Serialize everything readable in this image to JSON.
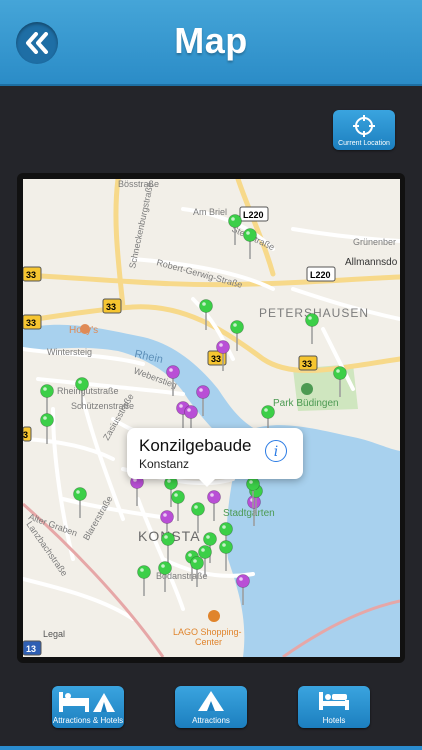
{
  "header": {
    "title": "Map",
    "back_icon": "double-chevron-left-icon"
  },
  "current_location": {
    "label": "Current Location",
    "icon": "crosshair-icon"
  },
  "map": {
    "callout": {
      "title": "Konzilgebaude",
      "subtitle": "Konstanz",
      "info_icon": "i"
    },
    "labels": {
      "boesstrasse": "Bösstraße",
      "schneckenburgstrasse": "Schneckenburgstraße",
      "am_briel": "Am Briel",
      "steinstrasse": "Steinstraße",
      "l220_a": "L220",
      "gruenenberg": "Grünenber",
      "allmannsdorf": "Allmannsdo",
      "robert_gerwig": "Robert-Gerwig-Straße",
      "l220_b": "L220",
      "b33_a": "33",
      "b33_b": "33",
      "b33_c": "33",
      "b33_d": "33",
      "b33_e": "33",
      "b33_f": "3",
      "petershausen": "PETERSHAUSEN",
      "hollys": "Holly's",
      "rhein": "Rhein",
      "wintersteig": "Wintersteig",
      "weberstieg": "Weberstieg",
      "rheingutstrasse": "Rheingutstraße",
      "park_buedingen": "Park Büdingen",
      "zasiusstrasse": "Zasiusstraße",
      "schuetzenstrasse": "Schützenstraße",
      "blarerstrasse": "Blarerstraße",
      "alter_graben": "Alter Graben",
      "stadtgarten": "Stadtgarten",
      "konstanz": "KONSTA",
      "lanzbachstrasse": "Lanzbachstraße",
      "bodanstrasse": "Bodanstraße",
      "lago_1": "LAGO Shopping-",
      "lago_2": "Center",
      "legal": "Legal",
      "route13": "13"
    },
    "pin_colors": {
      "green": "#3ccf48",
      "purple": "#b94fd6"
    },
    "pins": [
      {
        "color": "green"
      },
      {
        "color": "green"
      },
      {
        "color": "green"
      },
      {
        "color": "green"
      },
      {
        "color": "purple"
      },
      {
        "color": "green"
      },
      {
        "color": "green"
      },
      {
        "color": "purple"
      },
      {
        "color": "purple"
      },
      {
        "color": "purple"
      },
      {
        "color": "purple"
      },
      {
        "color": "green"
      },
      {
        "color": "green"
      },
      {
        "color": "green"
      },
      {
        "color": "green"
      },
      {
        "color": "purple"
      },
      {
        "color": "green"
      },
      {
        "color": "green"
      },
      {
        "color": "purple"
      },
      {
        "color": "purple"
      },
      {
        "color": "green"
      },
      {
        "color": "purple"
      },
      {
        "color": "green"
      },
      {
        "color": "green"
      },
      {
        "color": "green"
      },
      {
        "color": "green"
      },
      {
        "color": "green"
      },
      {
        "color": "green"
      },
      {
        "color": "green"
      },
      {
        "color": "green"
      },
      {
        "color": "green"
      },
      {
        "color": "purple"
      },
      {
        "color": "green"
      },
      {
        "color": "green"
      },
      {
        "color": "green"
      }
    ]
  },
  "toolbar": {
    "attractions_hotels": {
      "label": "Attractions & Hotels",
      "icon": "bed-tent-icon"
    },
    "attractions": {
      "label": "Attractions",
      "icon": "tent-icon"
    },
    "hotels": {
      "label": "Hotels",
      "icon": "bed-icon"
    }
  },
  "colors": {
    "accent": "#2b8cc7",
    "background": "#24252a",
    "water": "#a8d1ee",
    "park": "#cfe6bf"
  }
}
